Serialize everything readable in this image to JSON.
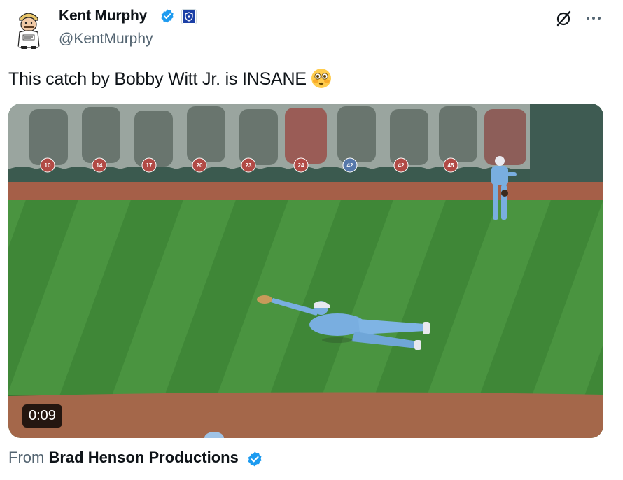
{
  "author": {
    "display_name": "Kent Murphy",
    "handle": "@KentMurphy",
    "avatar_icon": "cartoon-avatar-icon",
    "verified_icon": "verified-badge-icon",
    "affiliation_icon": "affiliation-badge-icon"
  },
  "header_actions": {
    "grok_icon": "grok-icon",
    "more_icon": "more-icon"
  },
  "tweet": {
    "text": "This catch by Bobby Witt Jr. is INSANE",
    "emoji": "flushed-face-emoji"
  },
  "video": {
    "duration": "0:09",
    "wall_numbers": [
      "10",
      "14",
      "17",
      "20",
      "23",
      "24",
      "42",
      "42",
      "45"
    ]
  },
  "source": {
    "prefix": "From",
    "name": "Brad Henson Productions",
    "verified_icon": "verified-badge-icon"
  },
  "colors": {
    "verified_blue": "#1d9bf0",
    "secondary_text": "#536471",
    "grass": "#3f8a3a",
    "infield_dirt": "#a4674a",
    "uniform_blue": "#79aee0"
  }
}
